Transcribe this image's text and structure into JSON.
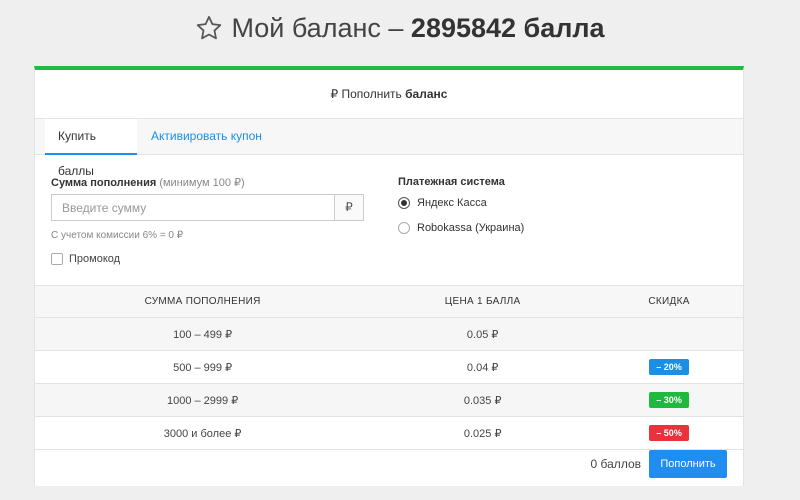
{
  "title": {
    "prefix": "Мой баланс –",
    "balance": "2895842 балла"
  },
  "card": {
    "header_prefix": "₽ Пополнить",
    "header_bold": "баланс"
  },
  "tabs": [
    {
      "label": "Купить баллы",
      "active": true
    },
    {
      "label": "Активировать купон",
      "active": false
    }
  ],
  "form": {
    "amount_label": "Сумма пополнения",
    "amount_hint_label": "(минимум 100 ₽)",
    "amount_placeholder": "Введите сумму",
    "amount_value": "",
    "currency_symbol": "₽",
    "commission_text": "С учетом комиссии 6% = 0 ₽",
    "promo_label": "Промокод",
    "promo_checked": false,
    "payment_label": "Платежная система",
    "payment_options": [
      {
        "label": "Яндекс Касса",
        "checked": true
      },
      {
        "label": "Robokassa (Украина)",
        "checked": false
      }
    ]
  },
  "rates_table": {
    "headers": [
      "СУММА ПОПОЛНЕНИЯ",
      "ЦЕНА 1 БАЛЛА",
      "СКИДКА"
    ],
    "rows": [
      {
        "range": "100 – 499 ₽",
        "price": "0.05 ₽",
        "discount": "",
        "badge_color": ""
      },
      {
        "range": "500 – 999 ₽",
        "price": "0.04 ₽",
        "discount": "– 20%",
        "badge_color": "#1a8fe3"
      },
      {
        "range": "1000 – 2999 ₽",
        "price": "0.035 ₽",
        "discount": "– 30%",
        "badge_color": "#20b940"
      },
      {
        "range": "3000 и более ₽",
        "price": "0.025 ₽",
        "discount": "– 50%",
        "badge_color": "#e8323c"
      }
    ]
  },
  "footer": {
    "points_text": "0 баллов",
    "submit_label": "Пополнить"
  },
  "colors": {
    "accent_green": "#1fbb45",
    "primary_blue": "#1f8ef0"
  }
}
